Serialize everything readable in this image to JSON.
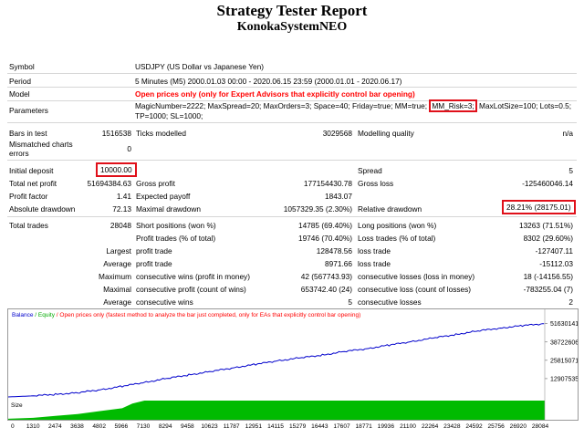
{
  "header": {
    "title": "Strategy Tester Report",
    "subtitle": "KonokaSystemNEO"
  },
  "info": {
    "symbol_label": "Symbol",
    "symbol_value": "USDJPY (US Dollar vs Japanese Yen)",
    "period_label": "Period",
    "period_value": "5 Minutes (M5) 2000.01.03 00:00 - 2020.06.15 23:59 (2000.01.01 - 2020.06.17)",
    "model_label": "Model",
    "model_value": "Open prices only (only for Expert Advisors that explicitly control bar opening)",
    "params_label": "Parameters",
    "params_pre": "MagicNumber=2222; MaxSpread=20; MaxOrders=3; Space=40; Friday=true; MM=true;",
    "params_box": "MM_Risk=3;",
    "params_post": "MaxLotSize=100; Lots=0.5;",
    "params_line2": "TP=1000; SL=1000;"
  },
  "stats": {
    "bars_label": "Bars in test",
    "bars_value": "1516538",
    "ticks_label": "Ticks modelled",
    "ticks_value": "3029568",
    "quality_label": "Modelling quality",
    "quality_value": "n/a",
    "mismatch_label1": "Mismatched charts",
    "mismatch_label2": "errors",
    "mismatch_value": "0",
    "deposit_label": "Initial deposit",
    "deposit_value": "10000.00",
    "spread_label": "Spread",
    "spread_value": "5",
    "netprofit_label": "Total net profit",
    "netprofit_value": "51694384.63",
    "grossprofit_label": "Gross profit",
    "grossprofit_value": "177154430.78",
    "grossloss_label": "Gross loss",
    "grossloss_value": "-125460046.14",
    "pf_label": "Profit factor",
    "pf_value": "1.41",
    "ep_label": "Expected payoff",
    "ep_value": "1843.07",
    "absdd_label": "Absolute drawdown",
    "absdd_value": "72.13",
    "maxdd_label": "Maximal drawdown",
    "maxdd_value": "1057329.35 (2.30%)",
    "reldd_label": "Relative drawdown",
    "reldd_value": "28.21% (28175.01)",
    "trades_label": "Total trades",
    "trades_value": "28048",
    "short_label": "Short positions (won %)",
    "short_value": "14785 (69.40%)",
    "long_label": "Long positions (won %)",
    "long_value": "13263 (71.51%)",
    "ptrades_label": "Profit trades (% of total)",
    "ptrades_value": "19746 (70.40%)",
    "ltrades_label": "Loss trades (% of total)",
    "ltrades_value": "8302 (29.60%)",
    "largest": "Largest",
    "lprofit_label": "profit trade",
    "lprofit_value": "128478.56",
    "lloss_label": "loss trade",
    "lloss_value": "-127407.11",
    "average": "Average",
    "aprofit_label": "profit trade",
    "aprofit_value": "8971.66",
    "aloss_label": "loss trade",
    "aloss_value": "-15112.03",
    "maximum": "Maximum",
    "mcw_label": "consecutive wins (profit in money)",
    "mcw_value": "42 (567743.93)",
    "mcl_label": "consecutive losses (loss in money)",
    "mcl_value": "18 (-14156.55)",
    "maximal": "Maximal",
    "mcp_label": "consecutive profit (count of wins)",
    "mcp_value": "653742.40 (24)",
    "mcloss_label": "consecutive loss (count of losses)",
    "mcloss_value": "-783255.04 (7)",
    "average2": "Average",
    "acw_label": "consecutive wins",
    "acw_value": "5",
    "acl_label": "consecutive losses",
    "acl_value": "2"
  },
  "chart_data": {
    "type": "line",
    "legend": [
      {
        "name": "Balance",
        "color": "#0000cc"
      },
      {
        "name": "Equity",
        "color": "#00aa00"
      }
    ],
    "legend_note": "/ Open prices only (fastest method to analyze the bar just completed, only for EAs that explicitly control bar opening)",
    "ylabels": [
      "51630141",
      "38722606",
      "25815071",
      "12907535"
    ],
    "y_ticks": [
      51630141,
      38722606,
      25815071,
      12907535
    ],
    "ylim": [
      0,
      54000000
    ],
    "xlabels": [
      "0",
      "1310",
      "2474",
      "3638",
      "4802",
      "5966",
      "7130",
      "8294",
      "9458",
      "10623",
      "11787",
      "12951",
      "14115",
      "15279",
      "16443",
      "17607",
      "18771",
      "19936",
      "21100",
      "22264",
      "23428",
      "24592",
      "25756",
      "26920",
      "28084"
    ],
    "xlim": [
      0,
      28084
    ],
    "balance": {
      "x": [
        0,
        1310,
        2474,
        3638,
        4802,
        5966,
        7130,
        8294,
        9458,
        10623,
        11787,
        12951,
        14115,
        15279,
        16443,
        17607,
        18771,
        19936,
        21100,
        22264,
        23428,
        24592,
        25756,
        26920,
        28048
      ],
      "y": [
        10000,
        800000,
        1800000,
        3000000,
        5000000,
        7500000,
        10200000,
        13000000,
        15500000,
        18000000,
        20500000,
        23000000,
        25500000,
        27500000,
        29500000,
        32000000,
        34000000,
        36500000,
        39000000,
        41500000,
        44000000,
        46500000,
        48500000,
        50200000,
        51630141
      ]
    },
    "size_panel_label": "Size",
    "size_profile": {
      "x": [
        0,
        1310,
        2474,
        3638,
        4802,
        5966,
        6500,
        7130,
        28084
      ],
      "level": [
        0.05,
        0.1,
        0.2,
        0.3,
        0.45,
        0.6,
        0.85,
        1.0,
        1.0
      ]
    },
    "balance_color": "#0000cc",
    "equity_color": "#00aa00",
    "size_color": "#00bb00"
  }
}
